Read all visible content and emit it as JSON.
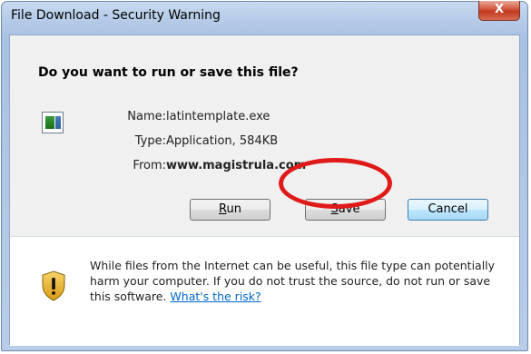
{
  "window": {
    "title": "File Download - Security Warning",
    "close_glyph": "X"
  },
  "dialog": {
    "question": "Do you want to run or save this file?",
    "file_icon": "application-file-icon",
    "fields": {
      "name_label": "Name:",
      "name_value": "latintemplate.exe",
      "type_label": "Type:",
      "type_value": "Application, 584KB",
      "from_label": "From:",
      "from_value": "www.magistrula.com"
    },
    "buttons": {
      "run_prefix": "",
      "run_accel": "R",
      "run_rest": "un",
      "save_accel": "S",
      "save_rest": "ave",
      "cancel": "Cancel"
    },
    "annotation": {
      "color": "#e01919"
    }
  },
  "warning": {
    "icon": "security-shield-icon",
    "text": "While files from the Internet can be useful, this file type can potentially harm your computer. If you do not trust the source, do not run or save this software.",
    "link": "What's the risk?"
  }
}
